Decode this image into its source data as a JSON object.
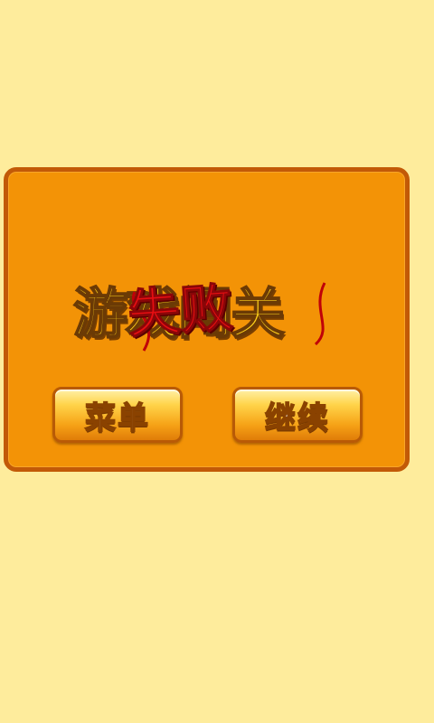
{
  "dialog": {
    "title_back": "游戏闯关",
    "title_front": "失败",
    "menu_label": "菜单",
    "continue_label": "继续"
  },
  "colors": {
    "page_background": "#FEEC9C",
    "dialog_fill": "#F39306",
    "dialog_border": "#C25A07",
    "title_gold": "#FFD21A",
    "title_red": "#E60E12",
    "button_gold": "#FFD44A"
  }
}
